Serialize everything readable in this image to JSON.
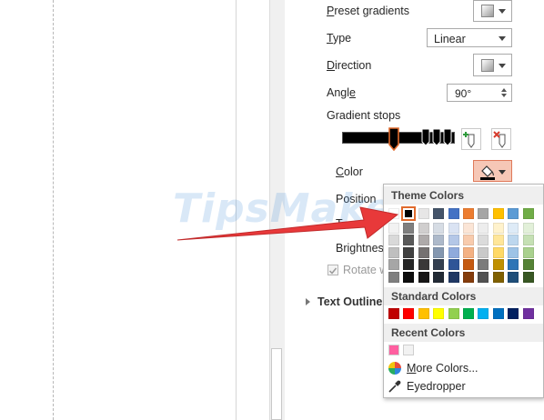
{
  "fill_panel": {
    "preset_gradients": {
      "label_u": "P",
      "label_rest": "reset gradients"
    },
    "type": {
      "label_u": "",
      "label_first": "T",
      "label_rest": "ype",
      "value": "Linear"
    },
    "direction": {
      "label_u": "D",
      "label_rest": "irection"
    },
    "angle": {
      "label_first": "Angl",
      "label_u": "e",
      "value": "90°"
    },
    "gradient_stops": {
      "label": "Gradient stops"
    },
    "color": {
      "label_first": "",
      "label_u": "C",
      "label_rest": "olor"
    },
    "position": {
      "label": "Position"
    },
    "transparency": {
      "label": "T"
    },
    "brightness": {
      "label": "Brightness"
    },
    "rotate": {
      "label": "Rotate w",
      "checked": true
    },
    "text_outline": {
      "label": "Text Outline"
    }
  },
  "color_popup": {
    "theme_header": "Theme Colors",
    "standard_header": "Standard Colors",
    "recent_header": "Recent Colors",
    "more_colors": {
      "u": "M",
      "rest": "ore Colors..."
    },
    "eyedropper": "Eyedropper",
    "theme_top": [
      "#ffffff",
      "#000000",
      "#e7e6e6",
      "#44546a",
      "#4472c4",
      "#ed7d31",
      "#a5a5a5",
      "#ffc000",
      "#5b9bd5",
      "#70ad47"
    ],
    "theme_shades": [
      [
        "#f2f2f2",
        "#7f7f7f",
        "#d0cece",
        "#d6dce4",
        "#dae3f3",
        "#fbe5d6",
        "#ededed",
        "#fff2cc",
        "#deebf7",
        "#e2f0d9"
      ],
      [
        "#d9d9d9",
        "#595959",
        "#aeaaaa",
        "#adb9ca",
        "#b4c7e7",
        "#f8cbad",
        "#dbdbdb",
        "#ffe699",
        "#bdd7ee",
        "#c5e0b4"
      ],
      [
        "#bfbfbf",
        "#404040",
        "#757171",
        "#8497b0",
        "#8faadc",
        "#f4b183",
        "#c9c9c9",
        "#ffd966",
        "#9dc3e6",
        "#a9d18e"
      ],
      [
        "#a6a6a6",
        "#262626",
        "#3a3838",
        "#333f50",
        "#2f5597",
        "#c55a11",
        "#7b7b7b",
        "#bf9000",
        "#2e75b6",
        "#548235"
      ],
      [
        "#7f7f7f",
        "#0d0d0d",
        "#171616",
        "#222a35",
        "#203864",
        "#843c0c",
        "#525252",
        "#7f6000",
        "#1f4e79",
        "#385723"
      ]
    ],
    "standard": [
      "#c00000",
      "#ff0000",
      "#ffc000",
      "#ffff00",
      "#92d050",
      "#00b050",
      "#00b0f0",
      "#0070c0",
      "#002060",
      "#7030a0"
    ],
    "recent": [
      "#ff5fa0",
      "#f2f2f2"
    ],
    "selected_index": 1
  },
  "watermark": "TipsMake",
  "colors": {
    "accent_button_bg": "#f6c7b6",
    "arrow": "#e8393a"
  }
}
